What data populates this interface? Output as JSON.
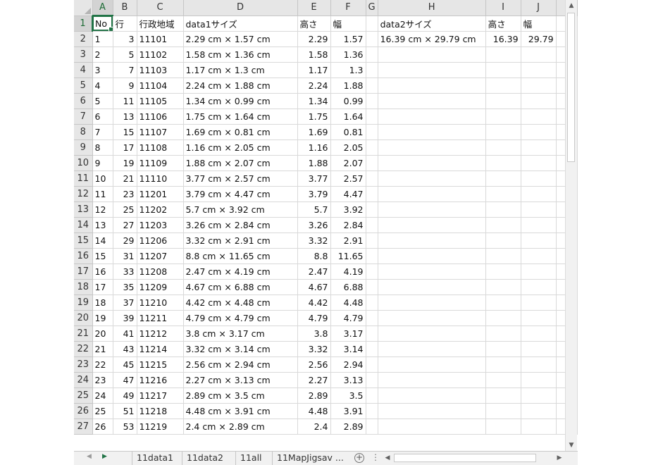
{
  "columns": [
    "A",
    "B",
    "C",
    "D",
    "E",
    "F",
    "G",
    "H",
    "I",
    "J"
  ],
  "header_row": {
    "no": "No",
    "row": "行",
    "code": "行政地域",
    "data1": "data1サイズ",
    "h": "高さ",
    "w": "幅",
    "g": "",
    "data2": "data2サイズ",
    "h2": "高さ",
    "w2": "幅"
  },
  "data2": {
    "size": "16.39 cm × 29.79 cm",
    "h": "16.39",
    "w": "29.79"
  },
  "rows": [
    {
      "no": "1",
      "row": "3",
      "code": "11101",
      "size": "2.29 cm × 1.57 cm",
      "h": "2.29",
      "w": "1.57"
    },
    {
      "no": "2",
      "row": "5",
      "code": "11102",
      "size": "1.58 cm × 1.36 cm",
      "h": "1.58",
      "w": "1.36"
    },
    {
      "no": "3",
      "row": "7",
      "code": "11103",
      "size": "1.17 cm × 1.3 cm",
      "h": "1.17",
      "w": "1.3"
    },
    {
      "no": "4",
      "row": "9",
      "code": "11104",
      "size": "2.24 cm × 1.88 cm",
      "h": "2.24",
      "w": "1.88"
    },
    {
      "no": "5",
      "row": "11",
      "code": "11105",
      "size": "1.34 cm × 0.99 cm",
      "h": "1.34",
      "w": "0.99"
    },
    {
      "no": "6",
      "row": "13",
      "code": "11106",
      "size": "1.75 cm × 1.64 cm",
      "h": "1.75",
      "w": "1.64"
    },
    {
      "no": "7",
      "row": "15",
      "code": "11107",
      "size": "1.69 cm × 0.81 cm",
      "h": "1.69",
      "w": "0.81"
    },
    {
      "no": "8",
      "row": "17",
      "code": "11108",
      "size": "1.16 cm × 2.05 cm",
      "h": "1.16",
      "w": "2.05"
    },
    {
      "no": "9",
      "row": "19",
      "code": "11109",
      "size": "1.88 cm × 2.07 cm",
      "h": "1.88",
      "w": "2.07"
    },
    {
      "no": "10",
      "row": "21",
      "code": "11110",
      "size": "3.77 cm × 2.57 cm",
      "h": "3.77",
      "w": "2.57"
    },
    {
      "no": "11",
      "row": "23",
      "code": "11201",
      "size": "3.79 cm × 4.47 cm",
      "h": "3.79",
      "w": "4.47"
    },
    {
      "no": "12",
      "row": "25",
      "code": "11202",
      "size": "5.7 cm × 3.92 cm",
      "h": "5.7",
      "w": "3.92"
    },
    {
      "no": "13",
      "row": "27",
      "code": "11203",
      "size": "3.26 cm × 2.84 cm",
      "h": "3.26",
      "w": "2.84"
    },
    {
      "no": "14",
      "row": "29",
      "code": "11206",
      "size": "3.32 cm × 2.91 cm",
      "h": "3.32",
      "w": "2.91"
    },
    {
      "no": "15",
      "row": "31",
      "code": "11207",
      "size": "8.8 cm × 11.65 cm",
      "h": "8.8",
      "w": "11.65"
    },
    {
      "no": "16",
      "row": "33",
      "code": "11208",
      "size": "2.47 cm × 4.19 cm",
      "h": "2.47",
      "w": "4.19"
    },
    {
      "no": "17",
      "row": "35",
      "code": "11209",
      "size": "4.67 cm × 6.88 cm",
      "h": "4.67",
      "w": "6.88"
    },
    {
      "no": "18",
      "row": "37",
      "code": "11210",
      "size": "4.42 cm × 4.48 cm",
      "h": "4.42",
      "w": "4.48"
    },
    {
      "no": "19",
      "row": "39",
      "code": "11211",
      "size": "4.79 cm × 4.79 cm",
      "h": "4.79",
      "w": "4.79"
    },
    {
      "no": "20",
      "row": "41",
      "code": "11212",
      "size": "3.8 cm × 3.17 cm",
      "h": "3.8",
      "w": "3.17"
    },
    {
      "no": "21",
      "row": "43",
      "code": "11214",
      "size": "3.32 cm × 3.14 cm",
      "h": "3.32",
      "w": "3.14"
    },
    {
      "no": "22",
      "row": "45",
      "code": "11215",
      "size": "2.56 cm × 2.94 cm",
      "h": "2.56",
      "w": "2.94"
    },
    {
      "no": "23",
      "row": "47",
      "code": "11216",
      "size": "2.27 cm × 3.13 cm",
      "h": "2.27",
      "w": "3.13"
    },
    {
      "no": "24",
      "row": "49",
      "code": "11217",
      "size": "2.89 cm × 3.5 cm",
      "h": "2.89",
      "w": "3.5"
    },
    {
      "no": "25",
      "row": "51",
      "code": "11218",
      "size": "4.48 cm × 3.91 cm",
      "h": "4.48",
      "w": "3.91"
    },
    {
      "no": "26",
      "row": "53",
      "code": "11219",
      "size": "2.4 cm × 2.89 cm",
      "h": "2.4",
      "w": "2.89"
    }
  ],
  "sheet_tabs": [
    "11data1",
    "11data2",
    "11all",
    "11MapJigsav ..."
  ],
  "icons": {
    "prev": "triangle-left-icon",
    "next": "triangle-right-icon",
    "add": "plus-circle-icon",
    "more": "vertical-ellipsis-icon",
    "scroll_up": "scroll-up-icon",
    "scroll_down": "scroll-down-icon"
  },
  "accent_color": "#217346"
}
